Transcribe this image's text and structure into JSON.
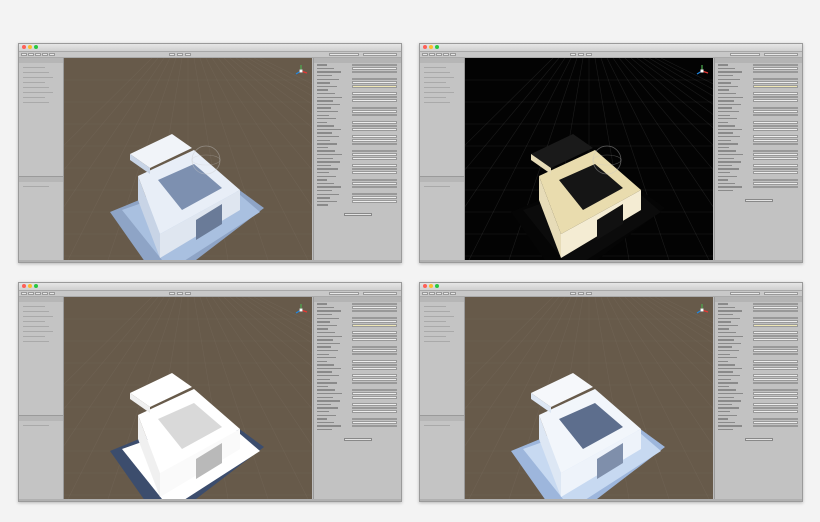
{
  "colors": {
    "close": "#ff5f57",
    "minimize": "#febc2e",
    "maximize": "#28c840",
    "scene_brown": "#675a4a",
    "scene_black": "#030303"
  },
  "icons": [
    "directional-light-icon",
    "scene-gizmo-icon"
  ],
  "panels": [
    {
      "variant": "shaded-gray"
    },
    {
      "variant": "lighting-only-dark"
    },
    {
      "variant": "flat-white"
    },
    {
      "variant": "lightmapped-blue"
    }
  ]
}
